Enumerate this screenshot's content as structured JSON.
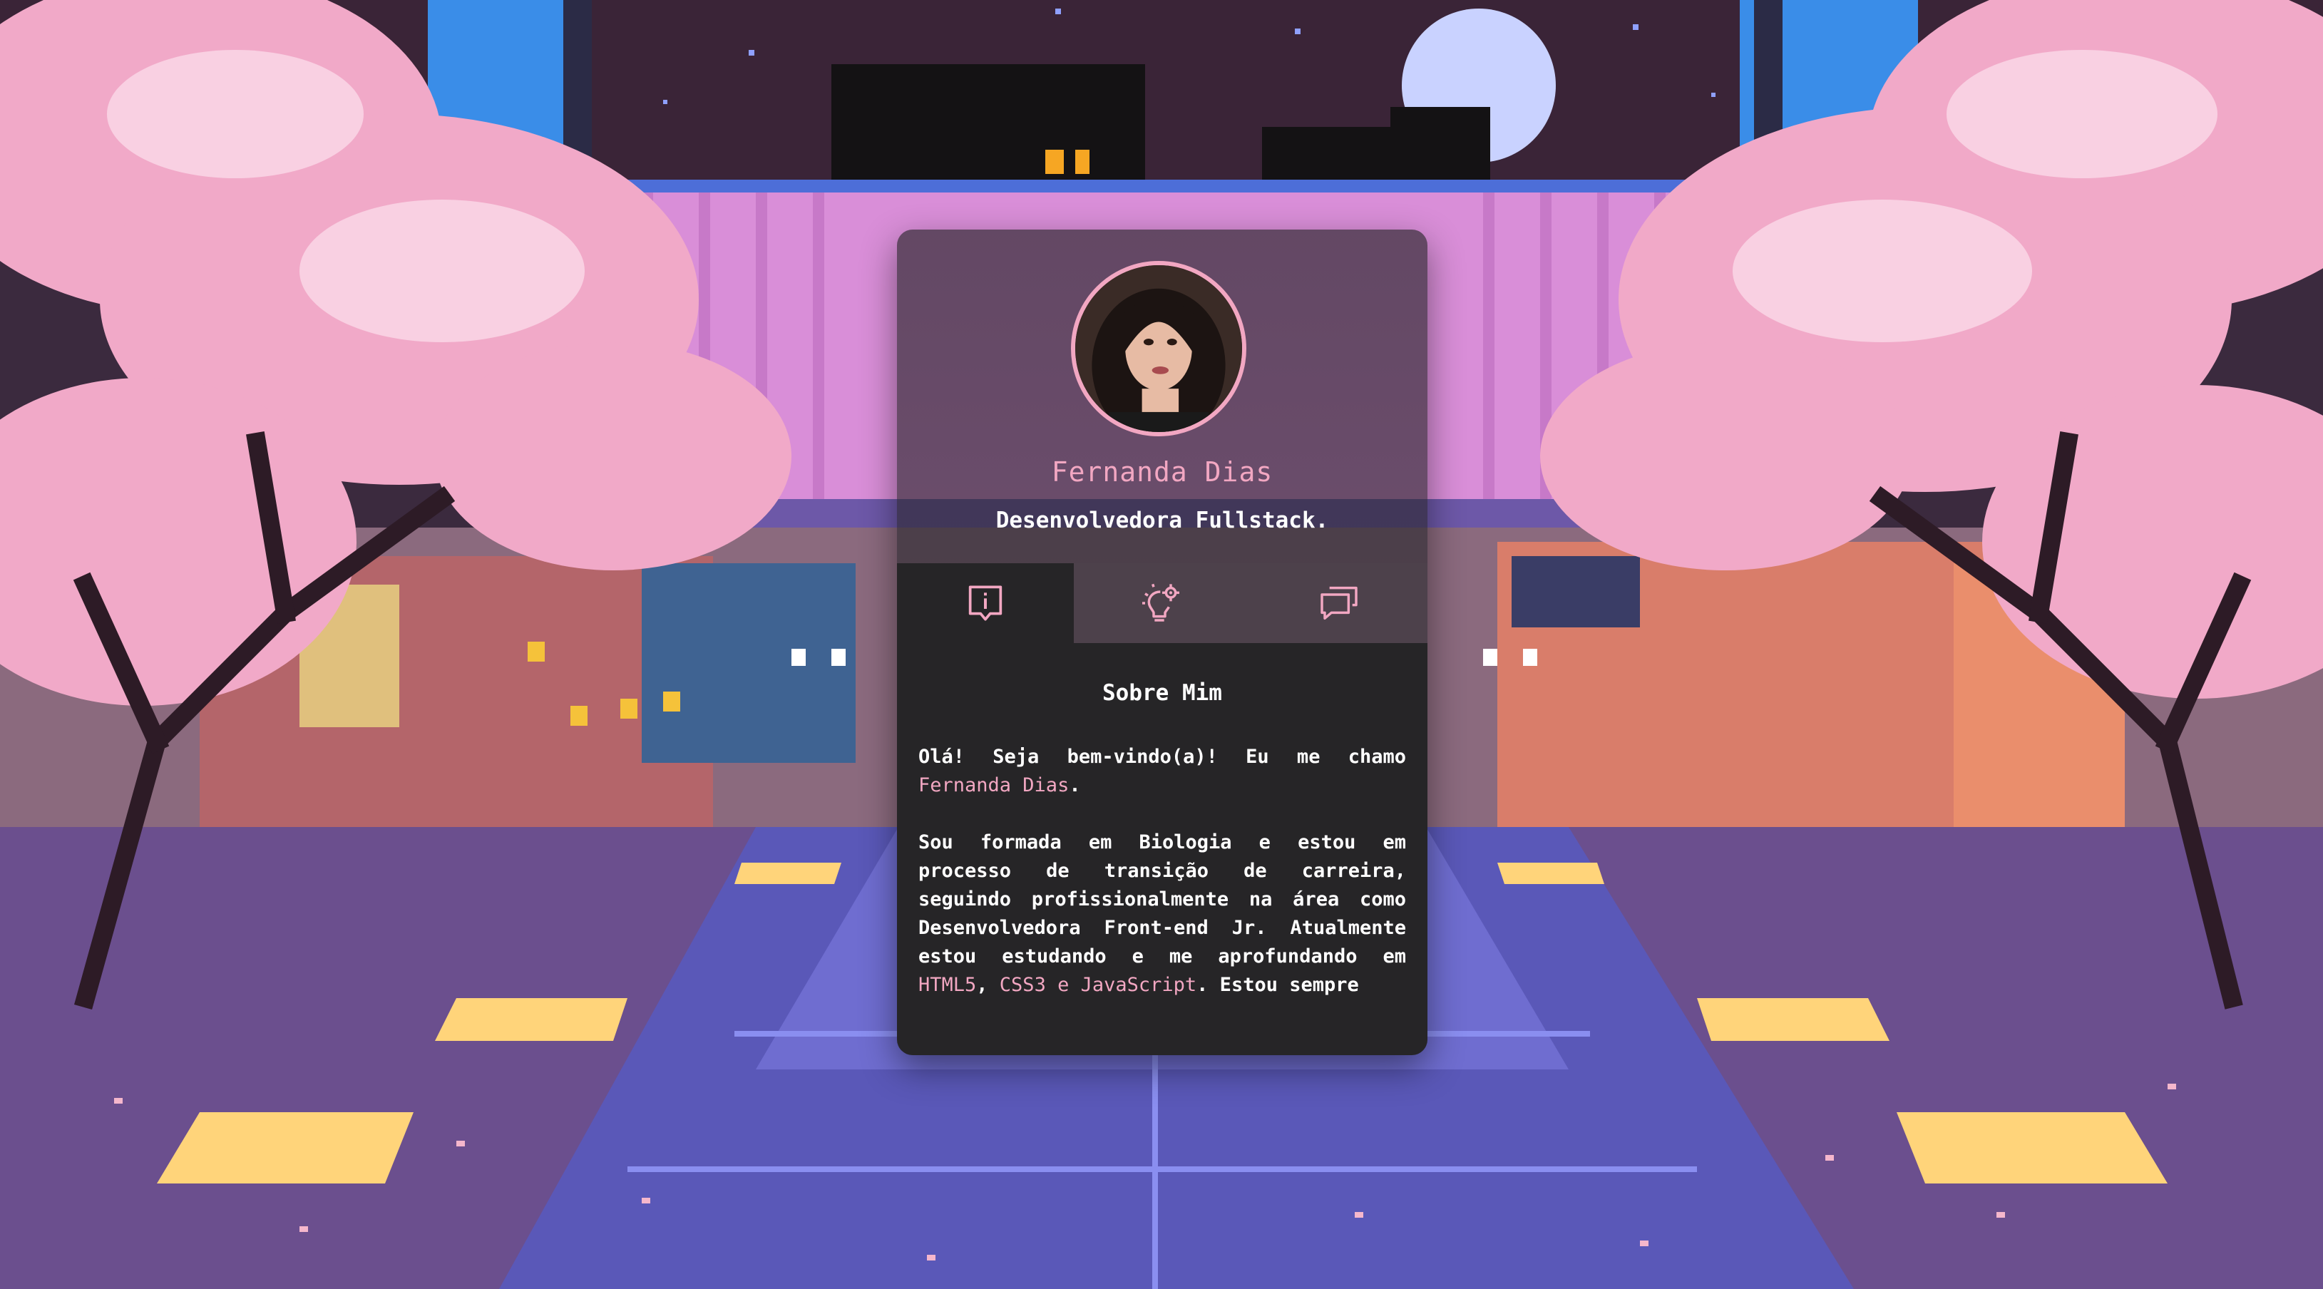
{
  "profile": {
    "name": "Fernanda Dias",
    "role": "Desenvolvedora Fullstack."
  },
  "tabs": [
    {
      "icon": "info-icon",
      "active": true
    },
    {
      "icon": "lightbulb-gear-icon",
      "active": false
    },
    {
      "icon": "chat-icon",
      "active": false
    }
  ],
  "about": {
    "title": "Sobre Mim",
    "p1_prefix": "Olá! Seja bem-vindo(a)! Eu me chamo ",
    "p1_name": "Fernanda Dias",
    "p1_suffix": ".",
    "p2_main": "Sou formada em Biologia e estou em processo de transição de carreira, seguindo profissionalmente na área como Desenvolvedora Front-end Jr. Atualmente estou estudando e me aprofundando em ",
    "p2_html": "HTML5",
    "p2_sep1": ", ",
    "p2_css": "CSS3",
    "p2_sep2": " e ",
    "p2_js": "JavaScript",
    "p2_end": ". Estou sempre"
  },
  "colors": {
    "accent": "#f2a7c2",
    "card": "#262527",
    "text": "#ffffff"
  }
}
